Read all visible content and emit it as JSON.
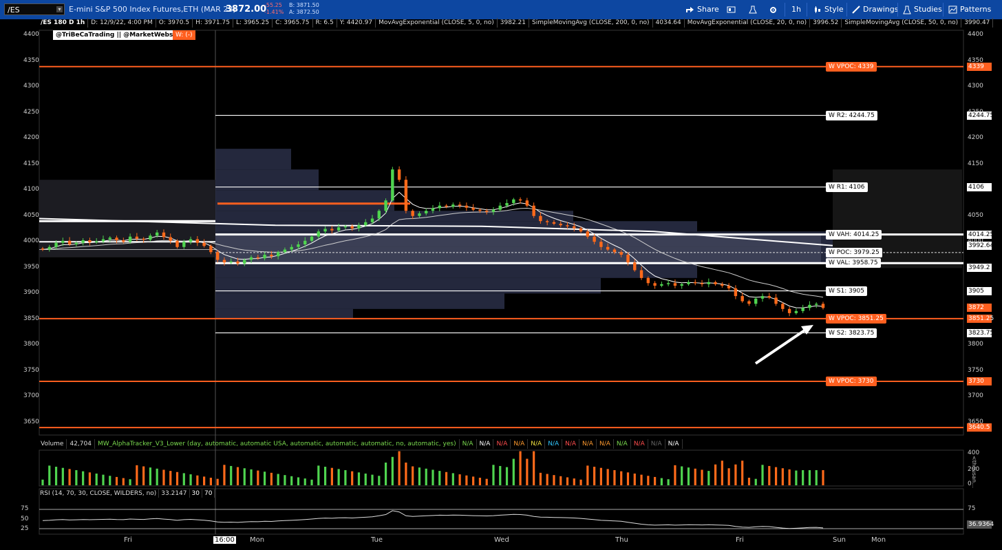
{
  "toolbar": {
    "symbol": "/ES",
    "description": "E-mini S&P 500 Index Futures,ETH (MAR 23)",
    "last_price": "3872.00",
    "change": "-55.25",
    "change_pct": "-1.41%",
    "bid": "B: 3871.50",
    "ask": "A: 3872.50",
    "buttons": {
      "share": "Share",
      "timeframe": "1h",
      "style": "Style",
      "drawings": "Drawings",
      "studies": "Studies",
      "patterns": "Patterns"
    }
  },
  "studies_bar": {
    "chart_id": "/ES 180 D 1h",
    "date": "D: 12/9/22, 4:00 PM",
    "open": "O: 3970.5",
    "high": "H: 3971.75",
    "low": "L: 3965.25",
    "close": "C: 3965.75",
    "range": "R: 6.5",
    "y": "Y: 4420.97",
    "ema5": "MovAvgExponential (CLOSE, 5, 0, no)",
    "ema5_val": "3982.21",
    "sma200": "SimpleMovingAvg (CLOSE, 200, 0, no)",
    "sma200_val": "4034.64",
    "ema20": "MovAvgExponential (CLOSE, 20, 0, no)",
    "ema20_val": "3996.52",
    "sma50": "SimpleMovingAvg (CLOSE, 50, 0, no)",
    "sma50_val": "3990.47"
  },
  "handle": "@TriBeCaTrading || @MarketWebs",
  "w_label": "W: (-)",
  "level_labels": [
    {
      "text": "W VPOC: 4339",
      "price": 4339,
      "style": "o"
    },
    {
      "text": "W R2: 4244.75",
      "price": 4244.75,
      "style": "w"
    },
    {
      "text": "W R1: 4106",
      "price": 4106,
      "style": "w"
    },
    {
      "text": "W VAH: 4014.25",
      "price": 4014.25,
      "style": "w"
    },
    {
      "text": "W POC: 3979.25",
      "price": 3979.25,
      "style": "w"
    },
    {
      "text": "W VAL: 3958.75",
      "price": 3958.75,
      "style": "w"
    },
    {
      "text": "W S1: 3905",
      "price": 3905,
      "style": "w"
    },
    {
      "text": "W VPOC: 3851.25",
      "price": 3851.25,
      "style": "o"
    },
    {
      "text": "W S2: 3823.75",
      "price": 3823.75,
      "style": "w"
    },
    {
      "text": "W VPOC: 3730",
      "price": 3730,
      "style": "o"
    }
  ],
  "price_tags": [
    {
      "text": "4339",
      "price": 4339,
      "style": "o"
    },
    {
      "text": "4244.75",
      "price": 4244.75,
      "style": "w"
    },
    {
      "text": "4106",
      "price": 4106,
      "style": "w"
    },
    {
      "text": "4014.25",
      "price": 4014.25,
      "style": "w"
    },
    {
      "text": "3992.64",
      "price": 3992.64,
      "style": "w"
    },
    {
      "text": "3949.2",
      "price": 3949.2,
      "style": "w"
    },
    {
      "text": "3905",
      "price": 3905,
      "style": "w"
    },
    {
      "text": "3872",
      "price": 3872,
      "style": "o"
    },
    {
      "text": "3851.25",
      "price": 3851.25,
      "style": "o"
    },
    {
      "text": "3823.75",
      "price": 3823.75,
      "style": "w"
    },
    {
      "text": "3730",
      "price": 3730,
      "style": "o"
    },
    {
      "text": "3640.5",
      "price": 3640.5,
      "style": "o"
    }
  ],
  "volume_bar": {
    "label": "Volume",
    "value": "42,704",
    "study": "MW_AlphaTracker_V3_Lower (day, automatic, automatic USA, automatic, automatic, automatic, no, automatic, yes)",
    "na_items": [
      {
        "text": "N/A",
        "color": "#7bdc4f"
      },
      {
        "text": "N/A",
        "color": "#ffffff"
      },
      {
        "text": "N/A",
        "color": "#ff4d4d"
      },
      {
        "text": "N/A",
        "color": "#ff9a2e"
      },
      {
        "text": "N/A",
        "color": "#f0e040"
      },
      {
        "text": "N/A",
        "color": "#32c8ff"
      },
      {
        "text": "N/A",
        "color": "#ff4d4d"
      },
      {
        "text": "N/A",
        "color": "#ff9a2e"
      },
      {
        "text": "N/A",
        "color": "#ff9a2e"
      },
      {
        "text": "N/A",
        "color": "#7bdc4f"
      },
      {
        "text": "N/A",
        "color": "#ff4d4d"
      },
      {
        "text": "N/A",
        "color": "#666666"
      },
      {
        "text": "N/A",
        "color": "#ffffff"
      }
    ],
    "ticks": [
      "400",
      "200",
      "0"
    ],
    "unit": "<thousan..."
  },
  "rsi_bar": {
    "label": "RSI (14, 70, 30, CLOSE, WILDERS, no)",
    "value": "33.2147",
    "ob": "30",
    "os": "70",
    "ticks": [
      "75",
      "50",
      "25"
    ],
    "right_ticks": [
      "75"
    ],
    "last_tag": "36.9364"
  },
  "x_labels": [
    "Fri",
    "16:00",
    "Mon",
    "Tue",
    "Wed",
    "Thu",
    "Fri",
    "Sun",
    "Mon"
  ],
  "colors": {
    "bull": "#4fd44f",
    "bear": "#ff6a1a",
    "level_orange": "#ff5f1f",
    "toolbar": "#0d47a1"
  },
  "chart_data": {
    "type": "candlestick",
    "y_ticks": [
      4400,
      4350,
      4300,
      4250,
      4200,
      4150,
      4100,
      4050,
      4000,
      3950,
      3900,
      3850,
      3800,
      3750,
      3700,
      3650
    ],
    "ylim": [
      3625,
      4415
    ],
    "candles": [
      3985,
      3990,
      3998,
      4002,
      3995,
      3998,
      4003,
      3999,
      4001,
      4005,
      4008,
      4003,
      4000,
      4010,
      4006,
      4004,
      4012,
      4018,
      4009,
      4002,
      3990,
      4000,
      4005,
      3998,
      3992,
      3980,
      3965,
      3960,
      3962,
      3958,
      3965,
      3970,
      3968,
      3975,
      3972,
      3980,
      3985,
      3990,
      3995,
      4002,
      4010,
      4020,
      4025,
      4022,
      4028,
      4030,
      4026,
      4032,
      4038,
      4045,
      4060,
      4080,
      4140,
      4120,
      4060,
      4050,
      4055,
      4060,
      4065,
      4070,
      4068,
      4072,
      4070,
      4066,
      4062,
      4060,
      4058,
      4062,
      4070,
      4075,
      4082,
      4080,
      4070,
      4050,
      4040,
      4038,
      4035,
      4032,
      4030,
      4026,
      4020,
      4010,
      4000,
      3990,
      3985,
      3980,
      3975,
      3960,
      3945,
      3930,
      3920,
      3915,
      3918,
      3920,
      3915,
      3918,
      3922,
      3920,
      3918,
      3922,
      3918,
      3915,
      3910,
      3895,
      3885,
      3880,
      3890,
      3895,
      3892,
      3880,
      3870,
      3862,
      3866,
      3872,
      3878,
      3880,
      3872
    ],
    "levels": [
      4339,
      4244.75,
      4106,
      4014.25,
      3979.25,
      3958.75,
      3905,
      3851.25,
      3823.75,
      3730,
      3640.5
    ],
    "rsi_levels": [
      75,
      25
    ]
  }
}
